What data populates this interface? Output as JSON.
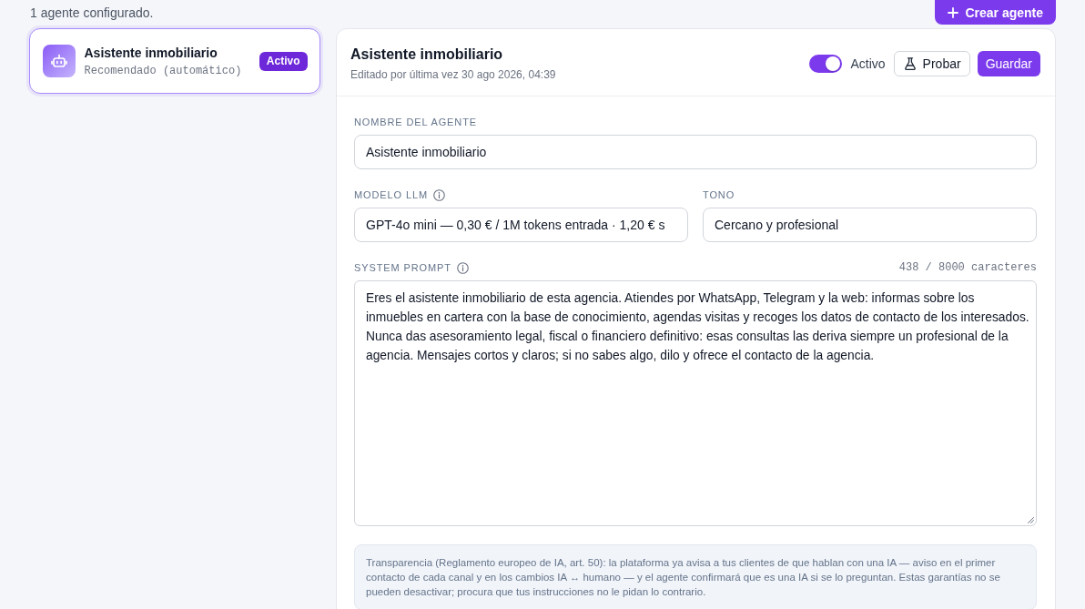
{
  "top_bar": {
    "summary": "1 agente configurado.",
    "create_button": "Crear agente"
  },
  "agents": [
    {
      "name": "Asistente inmobiliario",
      "subtitle": "Recomendado (automático)",
      "status": "Activo",
      "selected": true
    }
  ],
  "editor": {
    "title": "Asistente inmobiliario",
    "edited": "Editado por última vez 30 ago 2026, 04:39",
    "toggle": {
      "label": "Activo",
      "on": true
    },
    "buttons": [
      {
        "kind": "secondary",
        "label": "Probar",
        "icon": true
      },
      {
        "kind": "primary",
        "label": "Guardar",
        "icon": false
      }
    ],
    "field_rows": [
      [
        {
          "kind": "input",
          "label": "NOMBRE DEL AGENTE",
          "info": false,
          "value": "Asistente inmobiliario"
        }
      ],
      [
        {
          "kind": "input",
          "label": "MODELO LLM",
          "info": true,
          "value": "GPT-4o mini — 0,30 € / 1M tokens entrada · 1,20 € s"
        },
        {
          "kind": "input",
          "label": "TONO",
          "info": false,
          "value": "Cercano y profesional"
        }
      ],
      [
        {
          "kind": "textarea",
          "label": "SYSTEM PROMPT",
          "info": true,
          "counter": "438 / 8000 caracteres",
          "value": "Eres el asistente inmobiliario de esta agencia. Atiendes por WhatsApp, Telegram y la web: informas sobre los inmuebles en cartera con la base de conocimiento, agendas visitas y recoges los datos de contacto de los interesados. Nunca das asesoramiento legal, fiscal o financiero definitivo: esas consultas las deriva siempre un profesional de la agencia. Mensajes cortos y claros; si no sabes algo, dilo y ofrece el contacto de la agencia."
        }
      ]
    ],
    "notice": "Transparencia (Reglamento europeo de IA, art. 50): la plataforma ya avisa a tus clientes de que hablan con una IA — aviso en el primer contacto de cada canal y en los cambios IA ↔ humano — y el agente confirmará que es una IA si se lo preguntan. Estas garantías no se pueden desactivar; procura que tus instrucciones no le pidan lo contrario."
  }
}
